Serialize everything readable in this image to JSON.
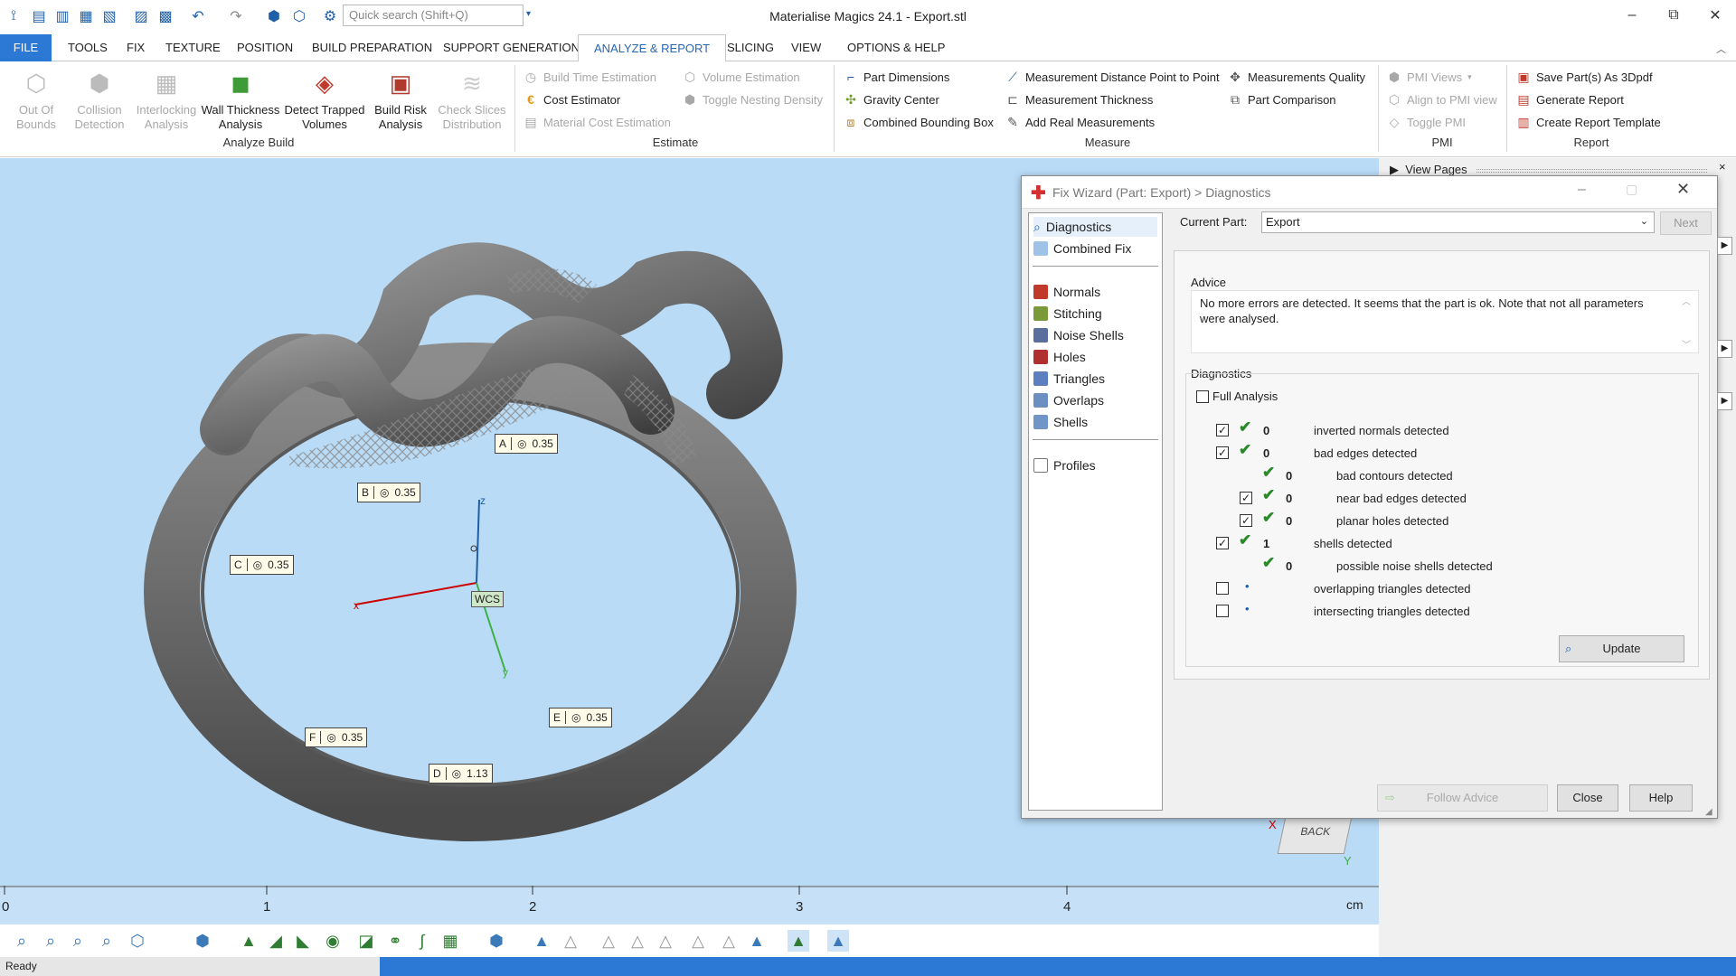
{
  "titlebar": {
    "title": "Materialise Magics 24.1 - Export.stl",
    "search_placeholder": "Quick search (Shift+Q)",
    "minimize": "–",
    "restore": "⧉",
    "close": "✕"
  },
  "tabs": [
    "FILE",
    "TOOLS",
    "FIX",
    "TEXTURE",
    "POSITION",
    "BUILD PREPARATION",
    "SUPPORT GENERATION",
    "ANALYZE & REPORT",
    "SLICING",
    "VIEW",
    "OPTIONS & HELP"
  ],
  "ribbon": {
    "analyze_build": {
      "label": "Analyze Build",
      "buttons": [
        {
          "label": "Out Of Bounds",
          "enabled": false
        },
        {
          "label": "Collision Detection",
          "enabled": false
        },
        {
          "label": "Interlocking Analysis",
          "enabled": false
        },
        {
          "label": "Wall Thickness Analysis",
          "enabled": true
        },
        {
          "label": "Detect Trapped Volumes",
          "enabled": true
        },
        {
          "label": "Build Risk Analysis",
          "enabled": true
        },
        {
          "label": "Check Slices Distribution",
          "enabled": false
        }
      ]
    },
    "estimate": {
      "label": "Estimate",
      "items": [
        "Build Time Estimation",
        "Cost Estimator",
        "Material Cost Estimation",
        "Volume Estimation",
        "Toggle Nesting Density"
      ]
    },
    "measure": {
      "label": "Measure",
      "items": [
        "Part Dimensions",
        "Gravity Center",
        "Combined Bounding Box",
        "Measurement Distance Point to Point",
        "Measurement Thickness",
        "Add Real Measurements",
        "Measurements Quality",
        "Part Comparison"
      ]
    },
    "pmi": {
      "label": "PMI",
      "items": [
        "PMI Views",
        "Align to PMI view",
        "Toggle PMI"
      ]
    },
    "report": {
      "label": "Report",
      "items": [
        "Save Part(s) As 3Dpdf",
        "Generate Report",
        "Create Report Template"
      ]
    }
  },
  "viewport": {
    "labels": [
      {
        "letter": "A",
        "value": "0.35"
      },
      {
        "letter": "B",
        "value": "0.35"
      },
      {
        "letter": "C",
        "value": "0.35"
      },
      {
        "letter": "D",
        "value": "1.13"
      },
      {
        "letter": "E",
        "value": "0.35"
      },
      {
        "letter": "F",
        "value": "0.35"
      }
    ],
    "axes": {
      "x": "x",
      "y": "y",
      "z": "z",
      "wcs": "WCS"
    },
    "cube": {
      "face": "BACK",
      "axis_x": "X",
      "axis_y": "Y"
    }
  },
  "ruler": {
    "ticks": [
      "0",
      "1",
      "2",
      "3",
      "4"
    ],
    "unit": "cm"
  },
  "side_panel": {
    "view_pages": "View Pages"
  },
  "dialog": {
    "title": "Fix Wizard (Part: Export) > Diagnostics",
    "nav_top": [
      "Diagnostics",
      "Combined Fix"
    ],
    "nav_mid": [
      "Normals",
      "Stitching",
      "Noise Shells",
      "Holes",
      "Triangles",
      "Overlaps",
      "Shells"
    ],
    "nav_bottom": [
      "Profiles"
    ],
    "current_part_label": "Current Part:",
    "current_part_value": "Export",
    "next_label": "Next",
    "advice_title": "Advice",
    "advice_text": "No more errors are detected. It seems that the part is ok. Note that not all parameters were analysed.",
    "diagnostics_title": "Diagnostics",
    "full_analysis": "Full Analysis",
    "rows": [
      {
        "checked": true,
        "ok": true,
        "count": "0",
        "label": "inverted normals detected",
        "indent": 0
      },
      {
        "checked": true,
        "ok": true,
        "count": "0",
        "label": "bad edges detected",
        "indent": 0
      },
      {
        "checked": null,
        "ok": true,
        "count": "0",
        "label": "bad contours detected",
        "indent": 1
      },
      {
        "checked": true,
        "ok": true,
        "count": "0",
        "label": "near bad edges detected",
        "indent": 1
      },
      {
        "checked": true,
        "ok": true,
        "count": "0",
        "label": "planar holes detected",
        "indent": 1
      },
      {
        "checked": true,
        "ok": true,
        "count": "1",
        "label": "shells detected",
        "indent": 0
      },
      {
        "checked": null,
        "ok": true,
        "count": "0",
        "label": "possible noise shells detected",
        "indent": 1
      },
      {
        "checked": false,
        "ok": false,
        "count": "",
        "label": "overlapping triangles detected",
        "indent": 0
      },
      {
        "checked": false,
        "ok": false,
        "count": "",
        "label": "intersecting triangles detected",
        "indent": 0
      }
    ],
    "update_label": "Update",
    "follow_advice_label": "Follow Advice",
    "close_label": "Close",
    "help_label": "Help"
  },
  "status": {
    "text": "Ready"
  }
}
